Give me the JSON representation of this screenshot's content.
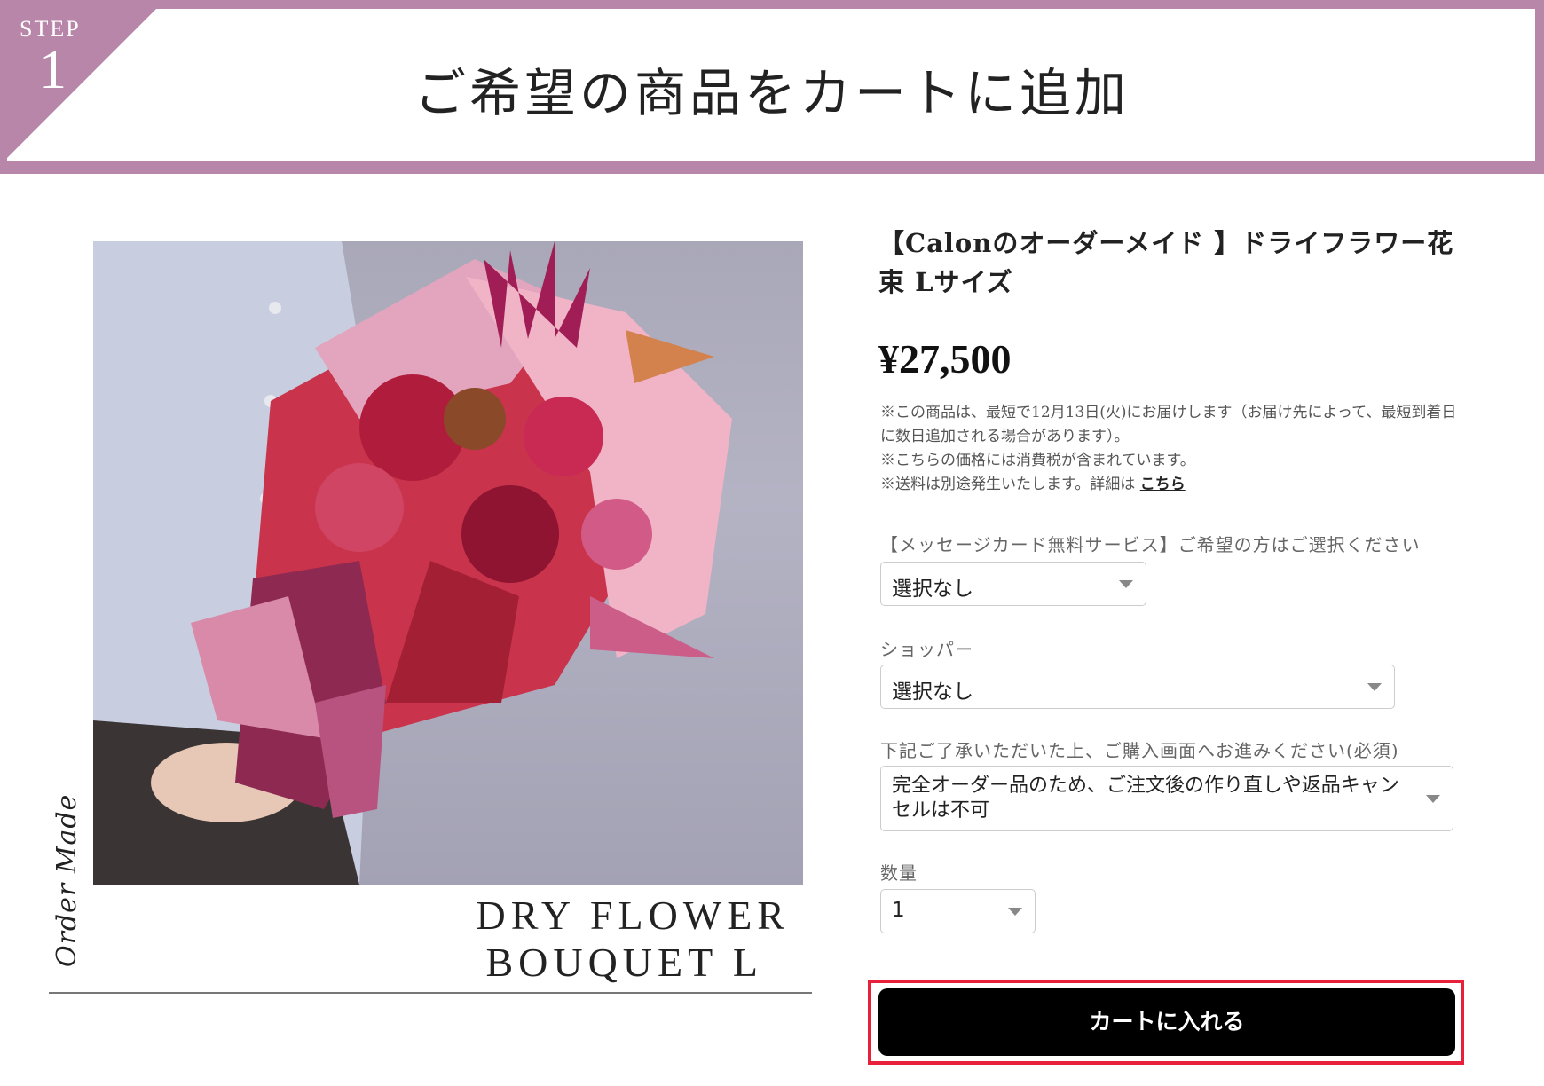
{
  "banner": {
    "step_label": "STEP",
    "step_number": "1",
    "title": "ご希望の商品をカートに追加",
    "accent_color": "#b886a8"
  },
  "product_image": {
    "caption_script": "Order Made",
    "caption_line1": "DRY FLOWER",
    "caption_line2": "BOUQUET L"
  },
  "product": {
    "title": "【Calonのオーダーメイド 】ドライフラワー花束 Lサイズ",
    "price": "¥27,500",
    "notes": [
      "※この商品は、最短で12月13日(火)にお届けします（お届け先によって、最短到着日に数日追加される場合があります）。",
      "※こちらの価格には消費税が含まれています。",
      "※送料は別途発生いたします。詳細は "
    ],
    "notes_link": "こちら"
  },
  "form": {
    "message_card_label": "【メッセージカード無料サービス】ご希望の方はご選択ください",
    "message_card_value": "選択なし",
    "shopper_label": "ショッパー",
    "shopper_value": "選択なし",
    "consent_label": "下記ご了承いただいた上、ご購入画面へお進みください(必須)",
    "consent_value": "完全オーダー品のため、ご注文後の作り直しや返品キャンセルは不可",
    "quantity_label": "数量",
    "quantity_value": "1"
  },
  "cart": {
    "button_label": "カートに入れる",
    "highlight_color": "#e8203c"
  }
}
